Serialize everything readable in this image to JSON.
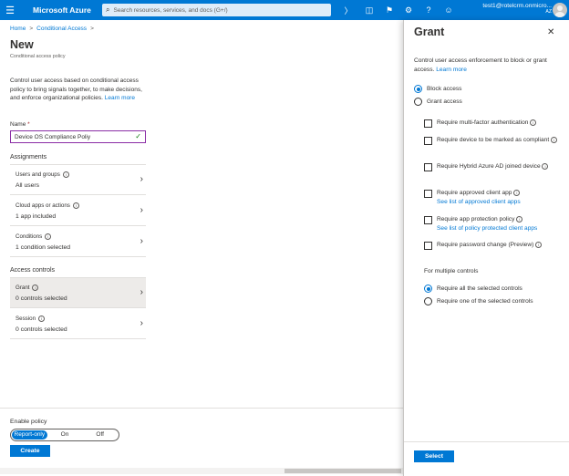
{
  "topbar": {
    "brand": "Microsoft Azure",
    "search_placeholder": "Search resources, services, and docs (G+/)",
    "account_email": "test1@rotelcrm.onmicro...",
    "account_tenant": "AZ",
    "icons": [
      "cloud-shell-icon",
      "directory-filter-icon",
      "notifications-icon",
      "settings-icon",
      "help-icon",
      "feedback-icon"
    ]
  },
  "breadcrumb": {
    "home": "Home",
    "conditional_access": "Conditional Access",
    "sep": ">"
  },
  "page": {
    "title": "New",
    "subtitle": "Conditional access policy",
    "intro": "Control user access based on conditional access policy to bring signals together, to make decisions, and enforce organizational policies.",
    "learn_more": "Learn more",
    "name_label": "Name",
    "name_required": "*",
    "name_value": "Device OS Compliance Poliy",
    "assignments_heading": "Assignments",
    "assignments": [
      {
        "title": "Users and groups",
        "value": "All users"
      },
      {
        "title": "Cloud apps or actions",
        "value": "1 app included"
      },
      {
        "title": "Conditions",
        "value": "1 condition selected"
      }
    ],
    "access_controls_heading": "Access controls",
    "access_controls": [
      {
        "title": "Grant",
        "value": "0 controls selected"
      },
      {
        "title": "Session",
        "value": "0 controls selected"
      }
    ],
    "enable_policy_label": "Enable policy",
    "enable_options": [
      "Report-only",
      "On",
      "Off"
    ],
    "enable_selected": "Report-only",
    "create_label": "Create"
  },
  "grant": {
    "title": "Grant",
    "intro": "Control user access enforcement to block or grant access.",
    "learn_more": "Learn more",
    "block_access": "Block access",
    "grant_access": "Grant access",
    "selected_mode": "Block access",
    "requirements": [
      {
        "label": "Require multi-factor authentication",
        "info": true,
        "link": ""
      },
      {
        "label": "Require device to be marked as compliant",
        "info": true,
        "link": ""
      },
      {
        "label": "Require Hybrid Azure AD joined device",
        "info": true,
        "link": ""
      },
      {
        "label": "Require approved client app",
        "info": true,
        "link": "See list of approved client apps"
      },
      {
        "label": "Require app protection policy",
        "info": true,
        "link": "See list of policy protected client apps"
      },
      {
        "label": "Require password change (Preview)",
        "info": true,
        "link": ""
      }
    ],
    "multiple_controls_label": "For multiple controls",
    "multiple_all": "Require all the selected controls",
    "multiple_one": "Require one of the selected controls",
    "multiple_selected": "Require all the selected controls",
    "select_label": "Select"
  },
  "colors": {
    "accent": "#0078d4",
    "topbar": "#0078d4",
    "input_border": "#8a2da5",
    "check": "#107c10"
  }
}
